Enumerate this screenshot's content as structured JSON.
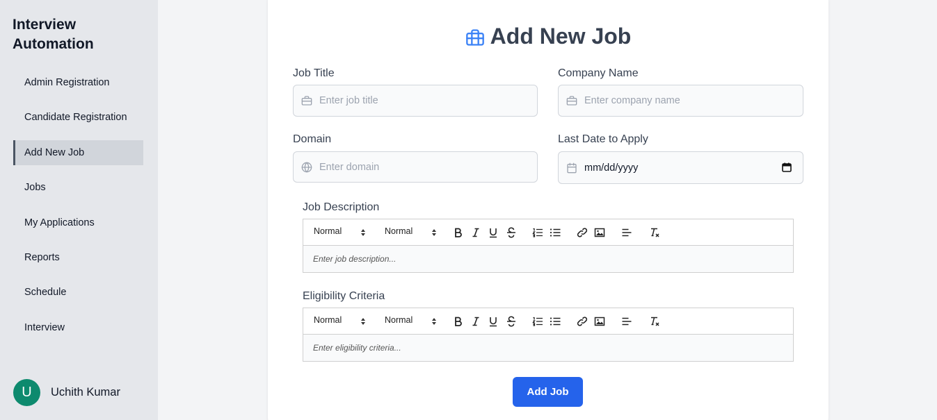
{
  "app": {
    "title": "Interview Automation"
  },
  "sidebar": {
    "items": [
      {
        "label": "Admin Registration"
      },
      {
        "label": "Candidate Registration"
      },
      {
        "label": "Add New Job",
        "active": true
      },
      {
        "label": "Jobs"
      },
      {
        "label": "My Applications"
      },
      {
        "label": "Reports"
      },
      {
        "label": "Schedule"
      },
      {
        "label": "Interview"
      }
    ],
    "user": {
      "initial": "U",
      "name": "Uchith Kumar"
    }
  },
  "form": {
    "title": "Add New Job",
    "title_icon": "briefcase-icon",
    "job_title": {
      "label": "Job Title",
      "placeholder": "Enter job title",
      "value": "",
      "icon": "briefcase-icon"
    },
    "company_name": {
      "label": "Company Name",
      "placeholder": "Enter company name",
      "value": "",
      "icon": "briefcase-icon"
    },
    "domain": {
      "label": "Domain",
      "placeholder": "Enter domain",
      "value": "",
      "icon": "globe-icon"
    },
    "last_date": {
      "label": "Last Date to Apply",
      "display": "mm/dd/yyyy",
      "icon": "calendar-icon"
    },
    "job_description": {
      "label": "Job Description",
      "placeholder": "Enter job description..."
    },
    "eligibility": {
      "label": "Eligibility Criteria",
      "placeholder": "Enter eligibility criteria..."
    },
    "toolbar": {
      "header_select": "Normal",
      "size_select": "Normal"
    },
    "submit_label": "Add Job"
  },
  "colors": {
    "sidebar_bg": "#e5e7eb",
    "active_item_bg": "#d1d5db",
    "primary": "#2563eb",
    "avatar": "#0d8a6e",
    "title_icon": "#3b82f6"
  }
}
